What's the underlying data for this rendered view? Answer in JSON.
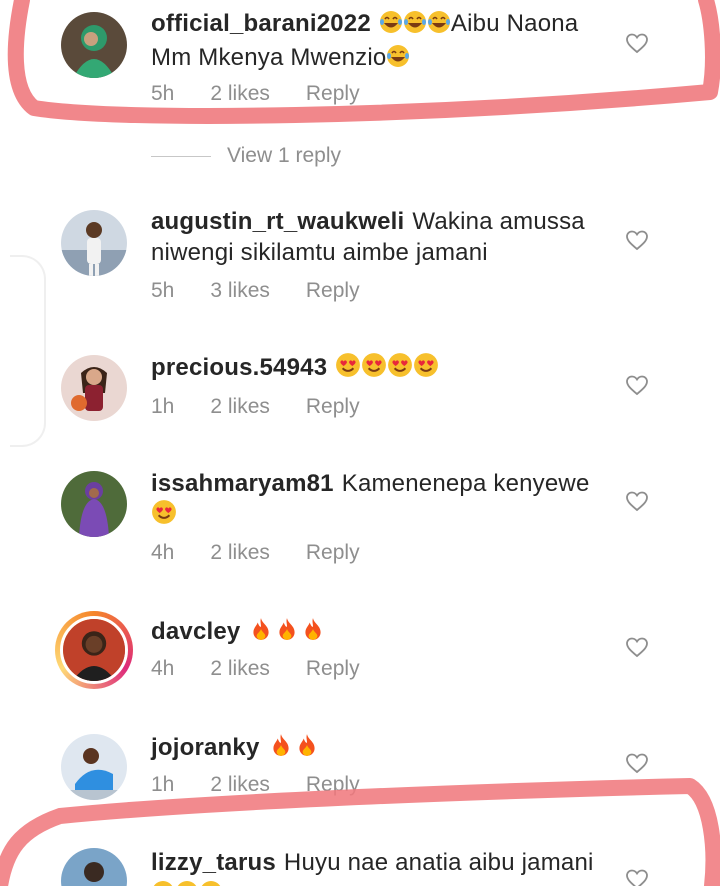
{
  "comments": [
    {
      "username": "official_barani2022",
      "text": "Aibu Naona Mm Mkenya Mwenzio",
      "lead_emojis": [
        "face-with-tears-of-joy",
        "face-with-tears-of-joy",
        "face-with-tears-of-joy"
      ],
      "trail_emojis": [
        "face-with-tears-of-joy"
      ],
      "time": "5h",
      "likes": "2 likes",
      "reply_label": "Reply",
      "view_replies": "View 1 reply",
      "highlighted": true
    },
    {
      "username": "augustin_rt_waukweli",
      "text": "Wakina amussa niwengi sikilamtu aimbe jamani",
      "time": "5h",
      "likes": "3 likes",
      "reply_label": "Reply"
    },
    {
      "username": "precious.54943",
      "text": "",
      "trail_emojis": [
        "smiling-face-with-heart-eyes",
        "smiling-face-with-heart-eyes",
        "smiling-face-with-heart-eyes",
        "smiling-face-with-heart-eyes"
      ],
      "time": "1h",
      "likes": "2 likes",
      "reply_label": "Reply"
    },
    {
      "username": "issahmaryam81",
      "text": "Kamenenepa kenyewe",
      "trail_emojis": [
        "smiling-face-with-heart-eyes"
      ],
      "time": "4h",
      "likes": "2 likes",
      "reply_label": "Reply"
    },
    {
      "username": "davcley",
      "text": "",
      "trail_emojis": [
        "fire",
        "fire",
        "fire"
      ],
      "time": "4h",
      "likes": "2 likes",
      "reply_label": "Reply",
      "story_ring": true
    },
    {
      "username": "jojoranky",
      "text": "",
      "trail_emojis": [
        "fire",
        "fire"
      ],
      "time": "1h",
      "likes": "2 likes",
      "reply_label": "Reply"
    },
    {
      "username": "lizzy_tarus",
      "text": "Huyu nae anatia aibu jamani",
      "trail_emojis": [
        "face-with-tears-of-joy",
        "face-with-tears-of-joy",
        "face-with-tears-of-joy"
      ],
      "highlighted": true
    }
  ],
  "icons": {
    "like": "heart-outline-icon"
  },
  "colors": {
    "text": "#262626",
    "meta": "#8e8e8e",
    "highlight_marker": "#f07a7e"
  }
}
